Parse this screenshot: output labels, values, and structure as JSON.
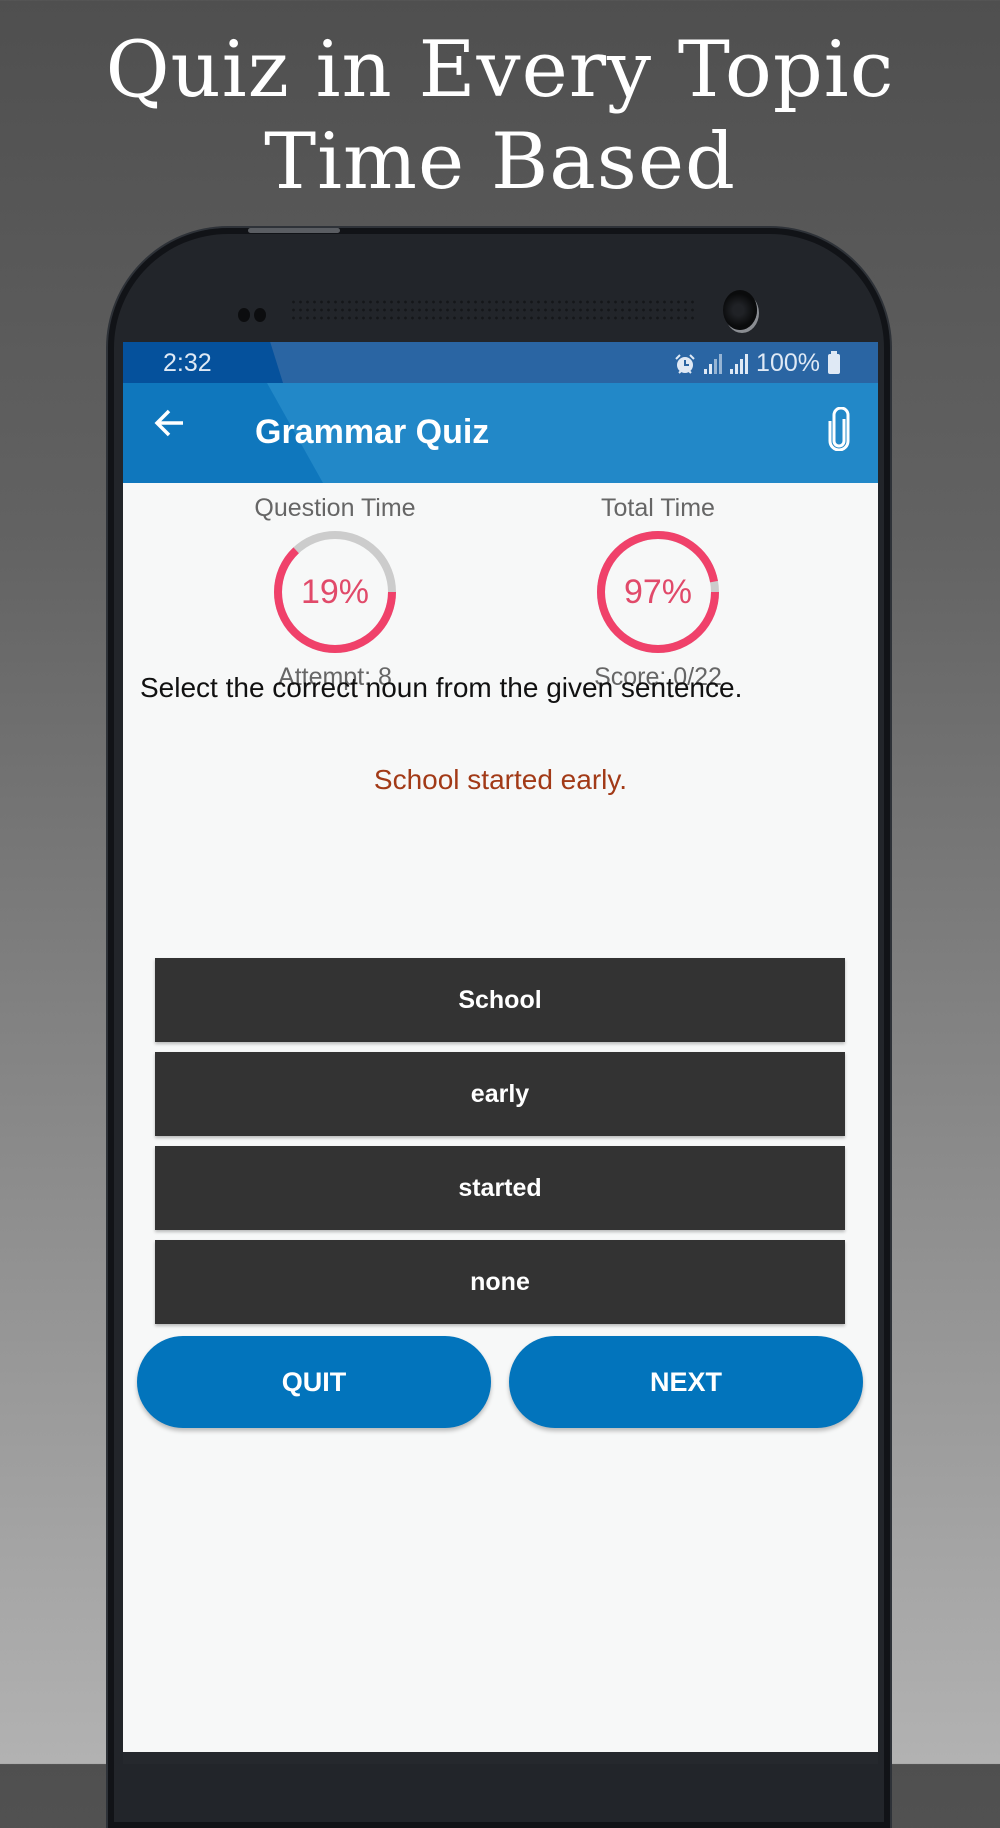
{
  "promo": {
    "line1": "Quiz in Every Topic",
    "line2": "Time Based"
  },
  "status_bar": {
    "time": "2:32",
    "icons": [
      "alarm-icon",
      "signal-icon",
      "signal-icon",
      "battery-icon"
    ],
    "battery": "100%"
  },
  "toolbar": {
    "back_icon": "arrow-left-icon",
    "title": "Grammar Quiz",
    "action_icon": "paperclip-icon"
  },
  "stats": {
    "question_time": {
      "label": "Question Time",
      "percent_text": "19%",
      "ring_remaining_fraction": 0.63,
      "sub": "Attempt: 8"
    },
    "total_time": {
      "label": "Total Time",
      "percent_text": "97%",
      "ring_remaining_fraction": 0.97,
      "sub": "Score: 0/22"
    }
  },
  "question": {
    "prompt": "Select the correct noun from the given sentence.",
    "sentence": "School started early."
  },
  "options": [
    "School",
    "early",
    "started",
    "none"
  ],
  "actions": {
    "quit": "QUIT",
    "next": "NEXT"
  },
  "colors": {
    "accent_blue": "#0274bc",
    "toolbar_blue": "#2288c8",
    "ring_active": "#f0416a",
    "ring_track": "#cccccc",
    "sentence": "#a23a17",
    "option_bg": "#333333"
  }
}
